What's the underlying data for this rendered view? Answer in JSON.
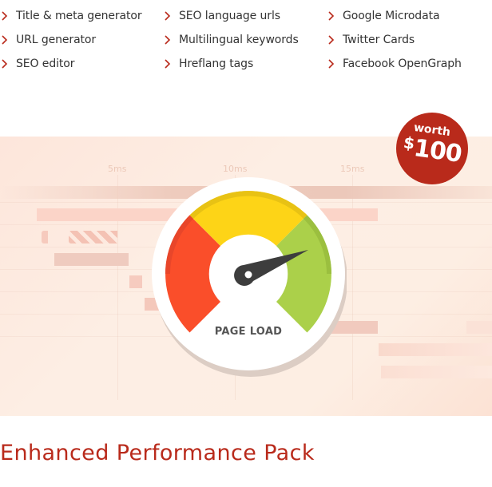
{
  "features": {
    "columns": [
      {
        "items": [
          "Title & meta generator",
          "URL generator",
          "SEO editor"
        ]
      },
      {
        "items": [
          "SEO language urls",
          "Multilingual keywords",
          "Hreflang tags"
        ]
      },
      {
        "items": [
          "Google Microdata",
          "Twitter Cards",
          "Facebook OpenGraph"
        ]
      }
    ],
    "bullet_icon": "chevron-right-icon",
    "bullet_color": "#b92a1b"
  },
  "hero": {
    "timeline_ticks": [
      "5ms",
      "10ms",
      "15ms"
    ],
    "gauge": {
      "label": "PAGE LOAD",
      "zones": [
        {
          "name": "slow",
          "color": "#fa4e2a"
        },
        {
          "name": "medium",
          "color": "#fdd417"
        },
        {
          "name": "fast",
          "color": "#abd04a"
        }
      ],
      "needle_color": "#3d3d3d"
    }
  },
  "badge": {
    "top_text": "worth",
    "currency": "$",
    "amount": "100",
    "color": "#b92a1b"
  },
  "title": "Enhanced Performance Pack"
}
